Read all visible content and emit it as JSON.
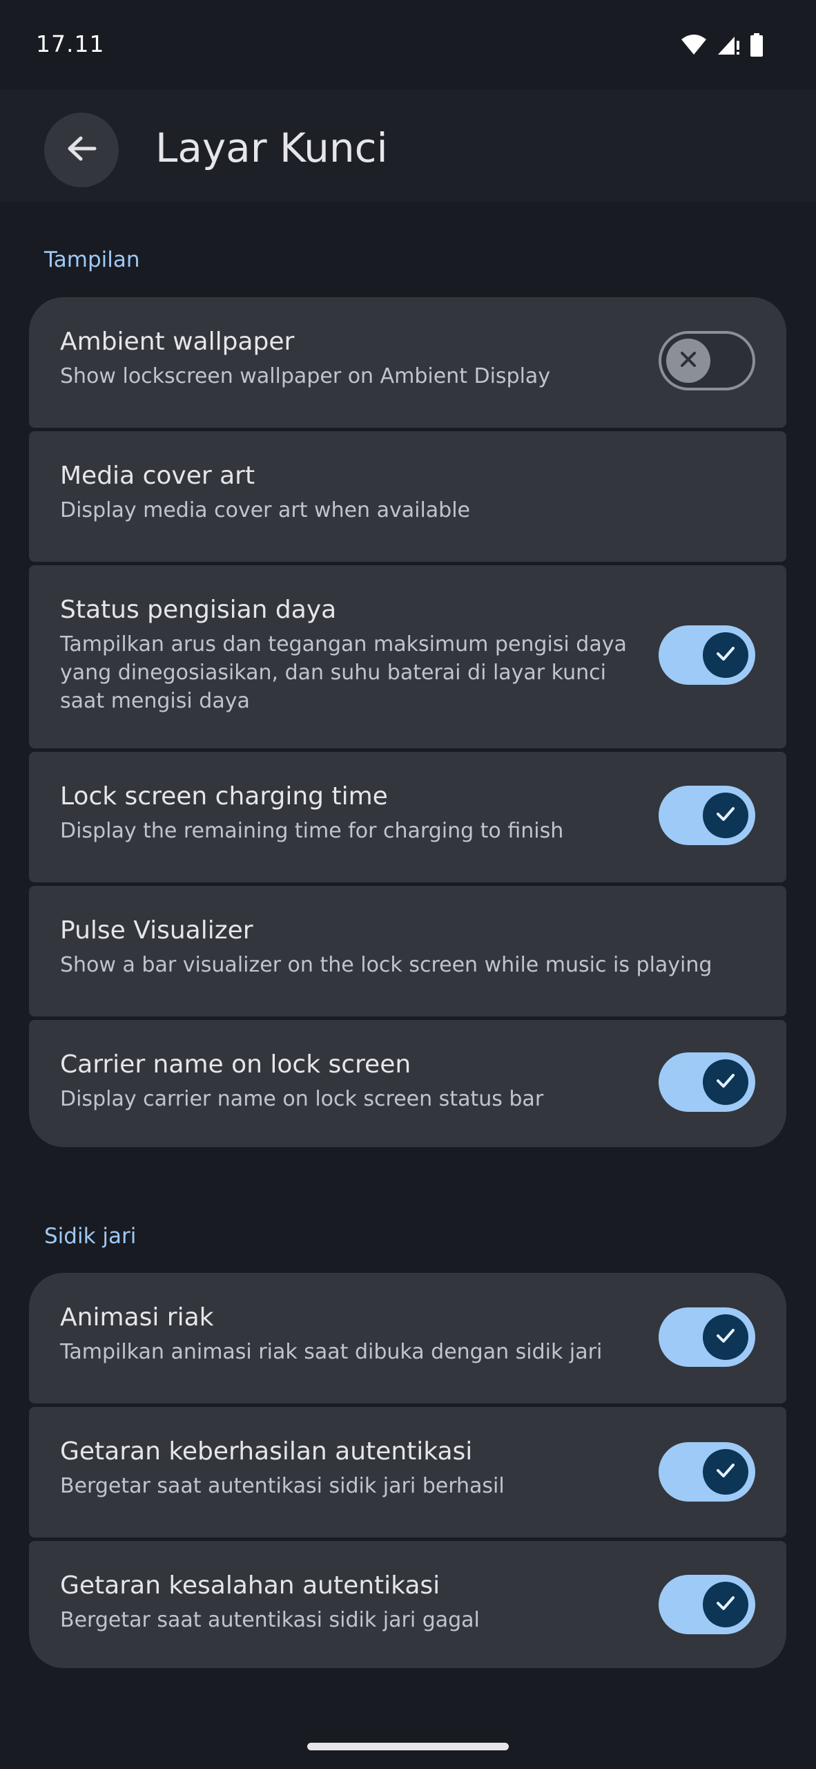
{
  "status_bar": {
    "time": "17.11",
    "icons": [
      "wifi-icon",
      "signal-icon",
      "battery-icon"
    ]
  },
  "app_bar": {
    "back_icon": "arrow-back-icon",
    "title": "Layar Kunci"
  },
  "sections": [
    {
      "header": "Tampilan",
      "items": [
        {
          "title": "Ambient wallpaper",
          "subtitle": "Show lockscreen wallpaper on Ambient Display",
          "toggle": "off"
        },
        {
          "title": "Media cover art",
          "subtitle": "Display media cover art when available",
          "toggle": "none"
        },
        {
          "title": "Status pengisian daya",
          "subtitle": "Tampilkan arus dan tegangan maksimum pengisi daya yang dinegosiasikan, dan suhu baterai di layar kunci saat mengisi daya",
          "toggle": "on"
        },
        {
          "title": "Lock screen charging time",
          "subtitle": "Display the remaining time for charging to finish",
          "toggle": "on"
        },
        {
          "title": "Pulse Visualizer",
          "subtitle": "Show a bar visualizer on the lock screen while music is playing",
          "toggle": "none"
        },
        {
          "title": "Carrier name on lock screen",
          "subtitle": "Display carrier name on lock screen status bar",
          "toggle": "on"
        }
      ]
    },
    {
      "header": "Sidik jari",
      "items": [
        {
          "title": "Animasi riak",
          "subtitle": "Tampilkan animasi riak saat dibuka dengan sidik jari",
          "toggle": "on"
        },
        {
          "title": "Getaran keberhasilan autentikasi",
          "subtitle": "Bergetar saat autentikasi sidik jari berhasil",
          "toggle": "on"
        },
        {
          "title": "Getaran kesalahan autentikasi",
          "subtitle": "Bergetar saat autentikasi sidik jari gagal",
          "toggle": "on"
        }
      ]
    }
  ],
  "colors": {
    "background": "#181b21",
    "app_bar": "#1d2026",
    "card": "#33363d",
    "accent": "#9ecaf7",
    "switch_thumb_on": "#0c3556",
    "section_header": "#9ec9f5"
  }
}
